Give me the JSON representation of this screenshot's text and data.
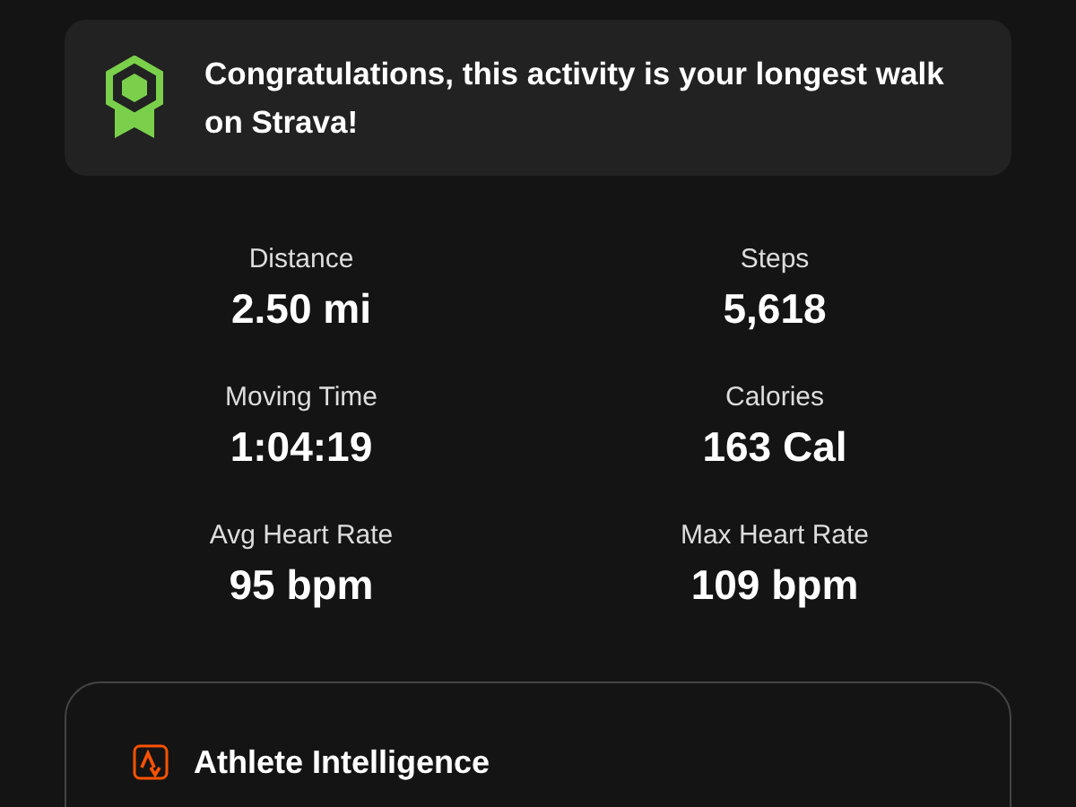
{
  "banner": {
    "message": "Congratulations, this activity is your longest walk on Strava!"
  },
  "stats": [
    {
      "label": "Distance",
      "value": "2.50 mi"
    },
    {
      "label": "Steps",
      "value": "5,618"
    },
    {
      "label": "Moving Time",
      "value": "1:04:19"
    },
    {
      "label": "Calories",
      "value": "163 Cal"
    },
    {
      "label": "Avg Heart Rate",
      "value": "95 bpm"
    },
    {
      "label": "Max Heart Rate",
      "value": "109 bpm"
    }
  ],
  "insight_card": {
    "title": "Athlete Intelligence"
  }
}
